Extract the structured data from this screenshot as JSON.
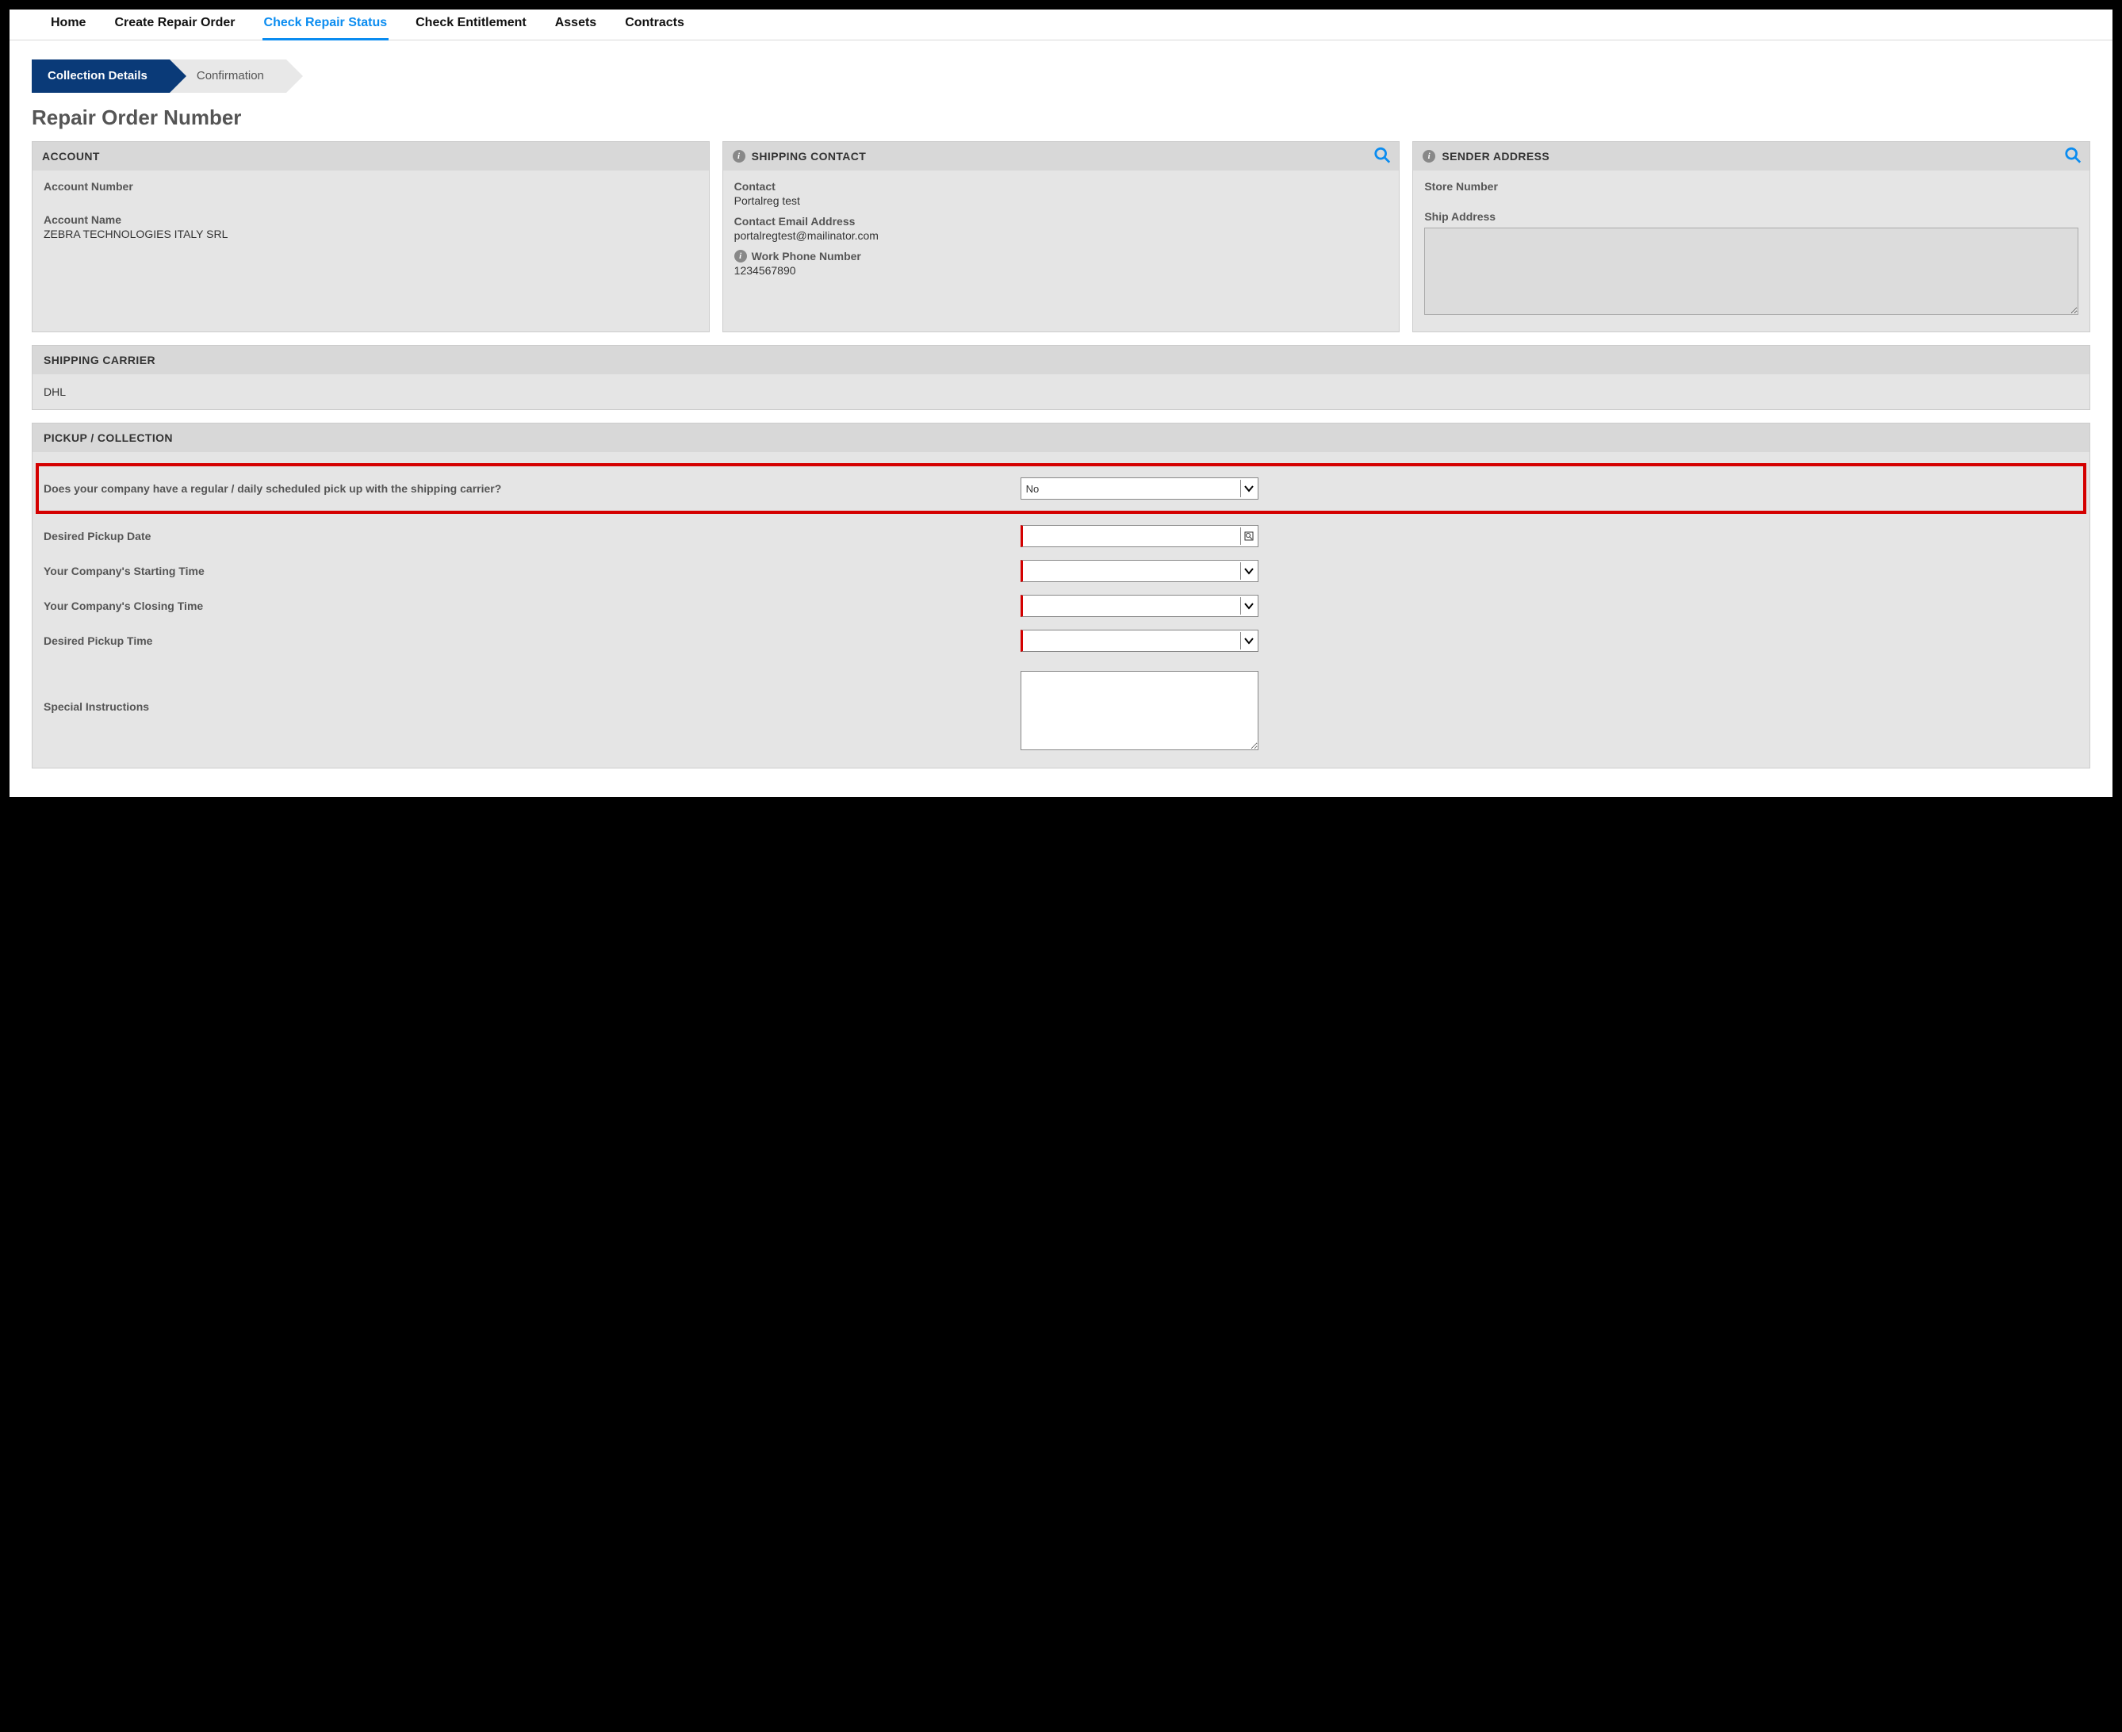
{
  "nav": {
    "items": [
      {
        "label": "Home",
        "active": false
      },
      {
        "label": "Create Repair Order",
        "active": false
      },
      {
        "label": "Check Repair Status",
        "active": true
      },
      {
        "label": "Check Entitlement",
        "active": false
      },
      {
        "label": "Assets",
        "active": false
      },
      {
        "label": "Contracts",
        "active": false
      }
    ]
  },
  "wizard": {
    "steps": [
      {
        "label": "Collection Details",
        "active": true
      },
      {
        "label": "Confirmation",
        "active": false
      }
    ]
  },
  "page_title": "Repair Order Number",
  "account": {
    "heading": "ACCOUNT",
    "number_label": "Account Number",
    "number_value": "",
    "name_label": "Account Name",
    "name_value": "ZEBRA TECHNOLOGIES ITALY SRL"
  },
  "shipping_contact": {
    "heading": "SHIPPING CONTACT",
    "contact_label": "Contact",
    "contact_value": "Portalreg test",
    "email_label": "Contact Email Address",
    "email_value": "portalregtest@mailinator.com",
    "phone_label": "Work Phone Number",
    "phone_value": "1234567890"
  },
  "sender_address": {
    "heading": "SENDER ADDRESS",
    "store_label": "Store Number",
    "store_value": "",
    "ship_label": "Ship Address",
    "ship_value": ""
  },
  "shipping_carrier": {
    "heading": "SHIPPING CARRIER",
    "value": "DHL"
  },
  "pickup": {
    "heading": "PICKUP / COLLECTION",
    "question_label": "Does your company have a regular / daily scheduled pick up with the shipping carrier?",
    "question_value": "No",
    "date_label": "Desired Pickup Date",
    "date_value": "",
    "start_label": "Your Company's Starting Time",
    "start_value": "",
    "close_label": "Your Company's Closing Time",
    "close_value": "",
    "pickup_time_label": "Desired Pickup Time",
    "pickup_time_value": "",
    "instructions_label": "Special Instructions",
    "instructions_value": ""
  },
  "colors": {
    "accent_blue": "#0a8cf0",
    "nav_active_underline": "#0a8cf0",
    "wizard_active_bg": "#0a3a78",
    "highlight_red": "#d40000",
    "panel_bg": "#e5e5e5",
    "panel_head_bg": "#d8d8d8"
  }
}
